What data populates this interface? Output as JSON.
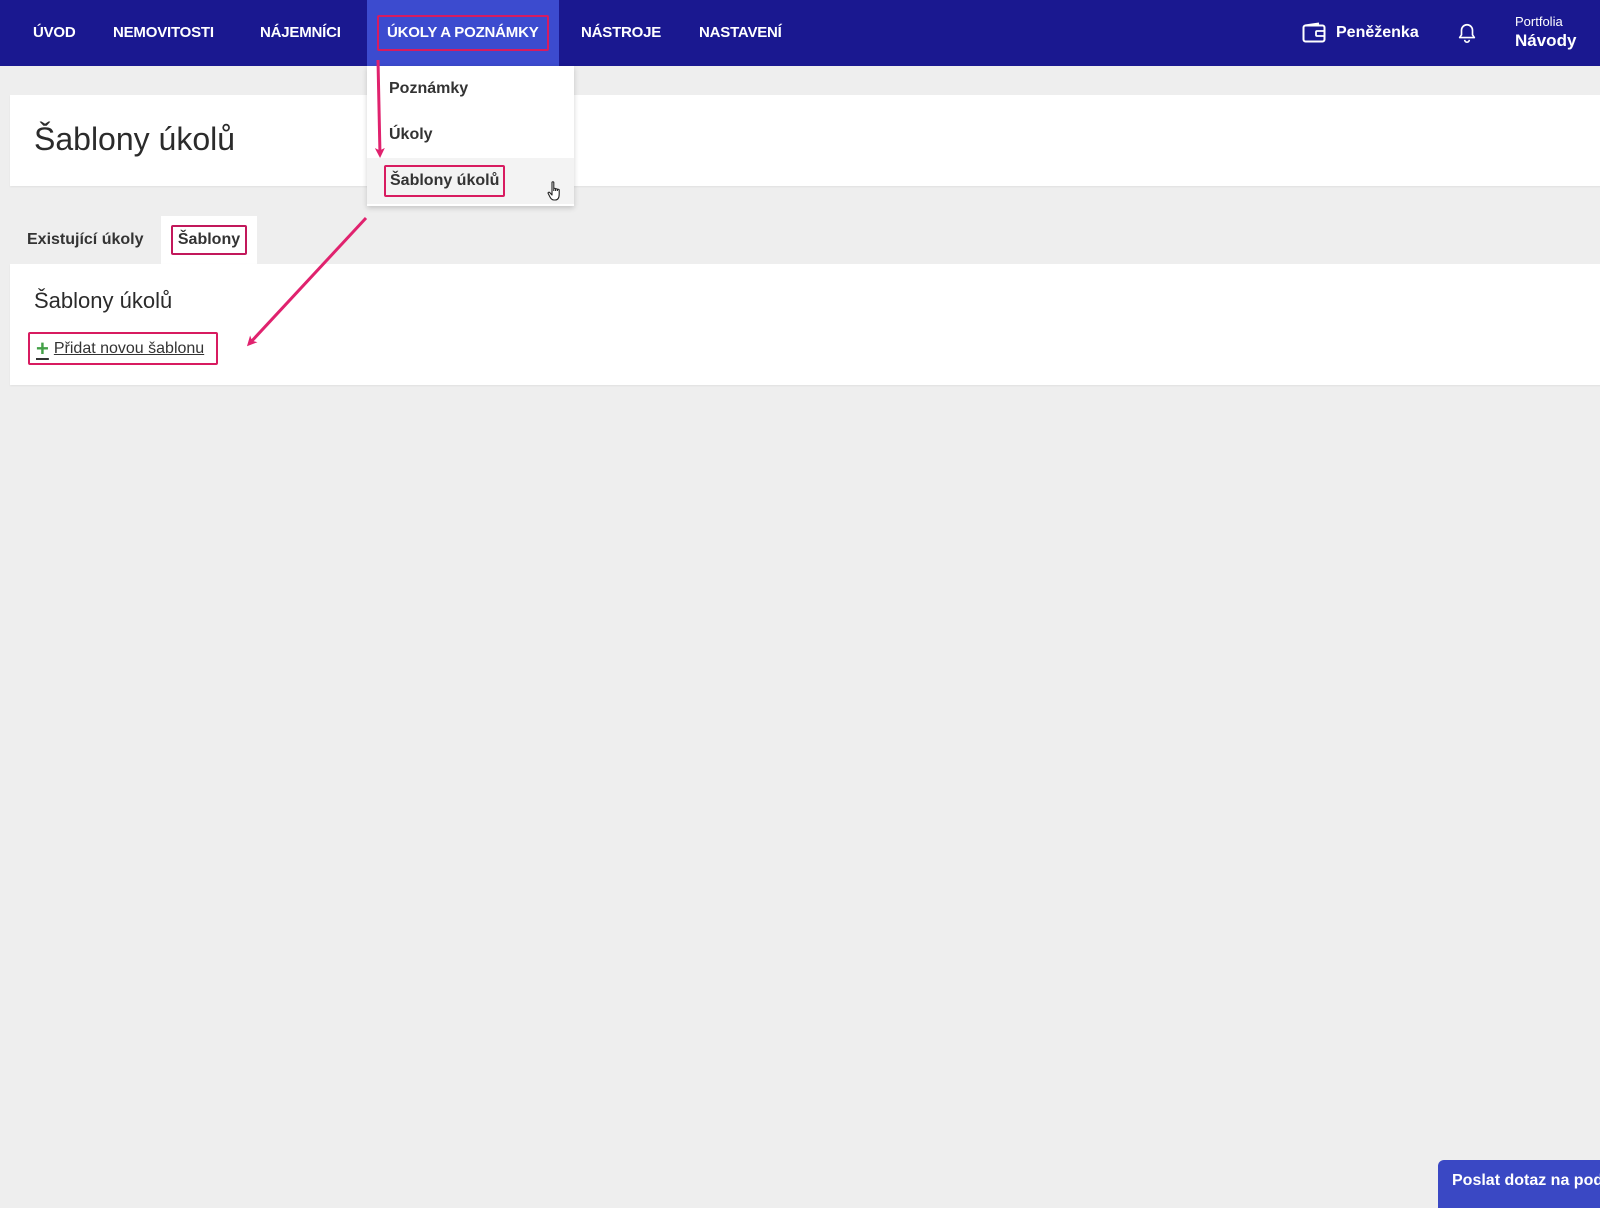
{
  "nav": {
    "items": [
      "ÚVOD",
      "NEMOVITOSTI",
      "NÁJEMNÍCI",
      "ÚKOLY A POZNÁMKY",
      "NÁSTROJE",
      "NASTAVENÍ"
    ],
    "wallet_label": "Peněženka",
    "portfolio_sub": "Portfolia",
    "portfolio_name": "Návody"
  },
  "dropdown": {
    "items": [
      "Poznámky",
      "Úkoly",
      "Šablony úkolů"
    ]
  },
  "page": {
    "title": "Šablony úkolů"
  },
  "tabs": {
    "existing": "Existující úkoly",
    "templates": "Šablony"
  },
  "templates": {
    "title": "Šablony úkolů",
    "add_label": "Přidat novou šablonu"
  },
  "support": {
    "label": "Poslat dotaz na podporu"
  },
  "colors": {
    "topbar": "#1a1890",
    "active_nav": "#3c4bcf",
    "highlight": "#d81b60",
    "plus": "#43a047"
  }
}
